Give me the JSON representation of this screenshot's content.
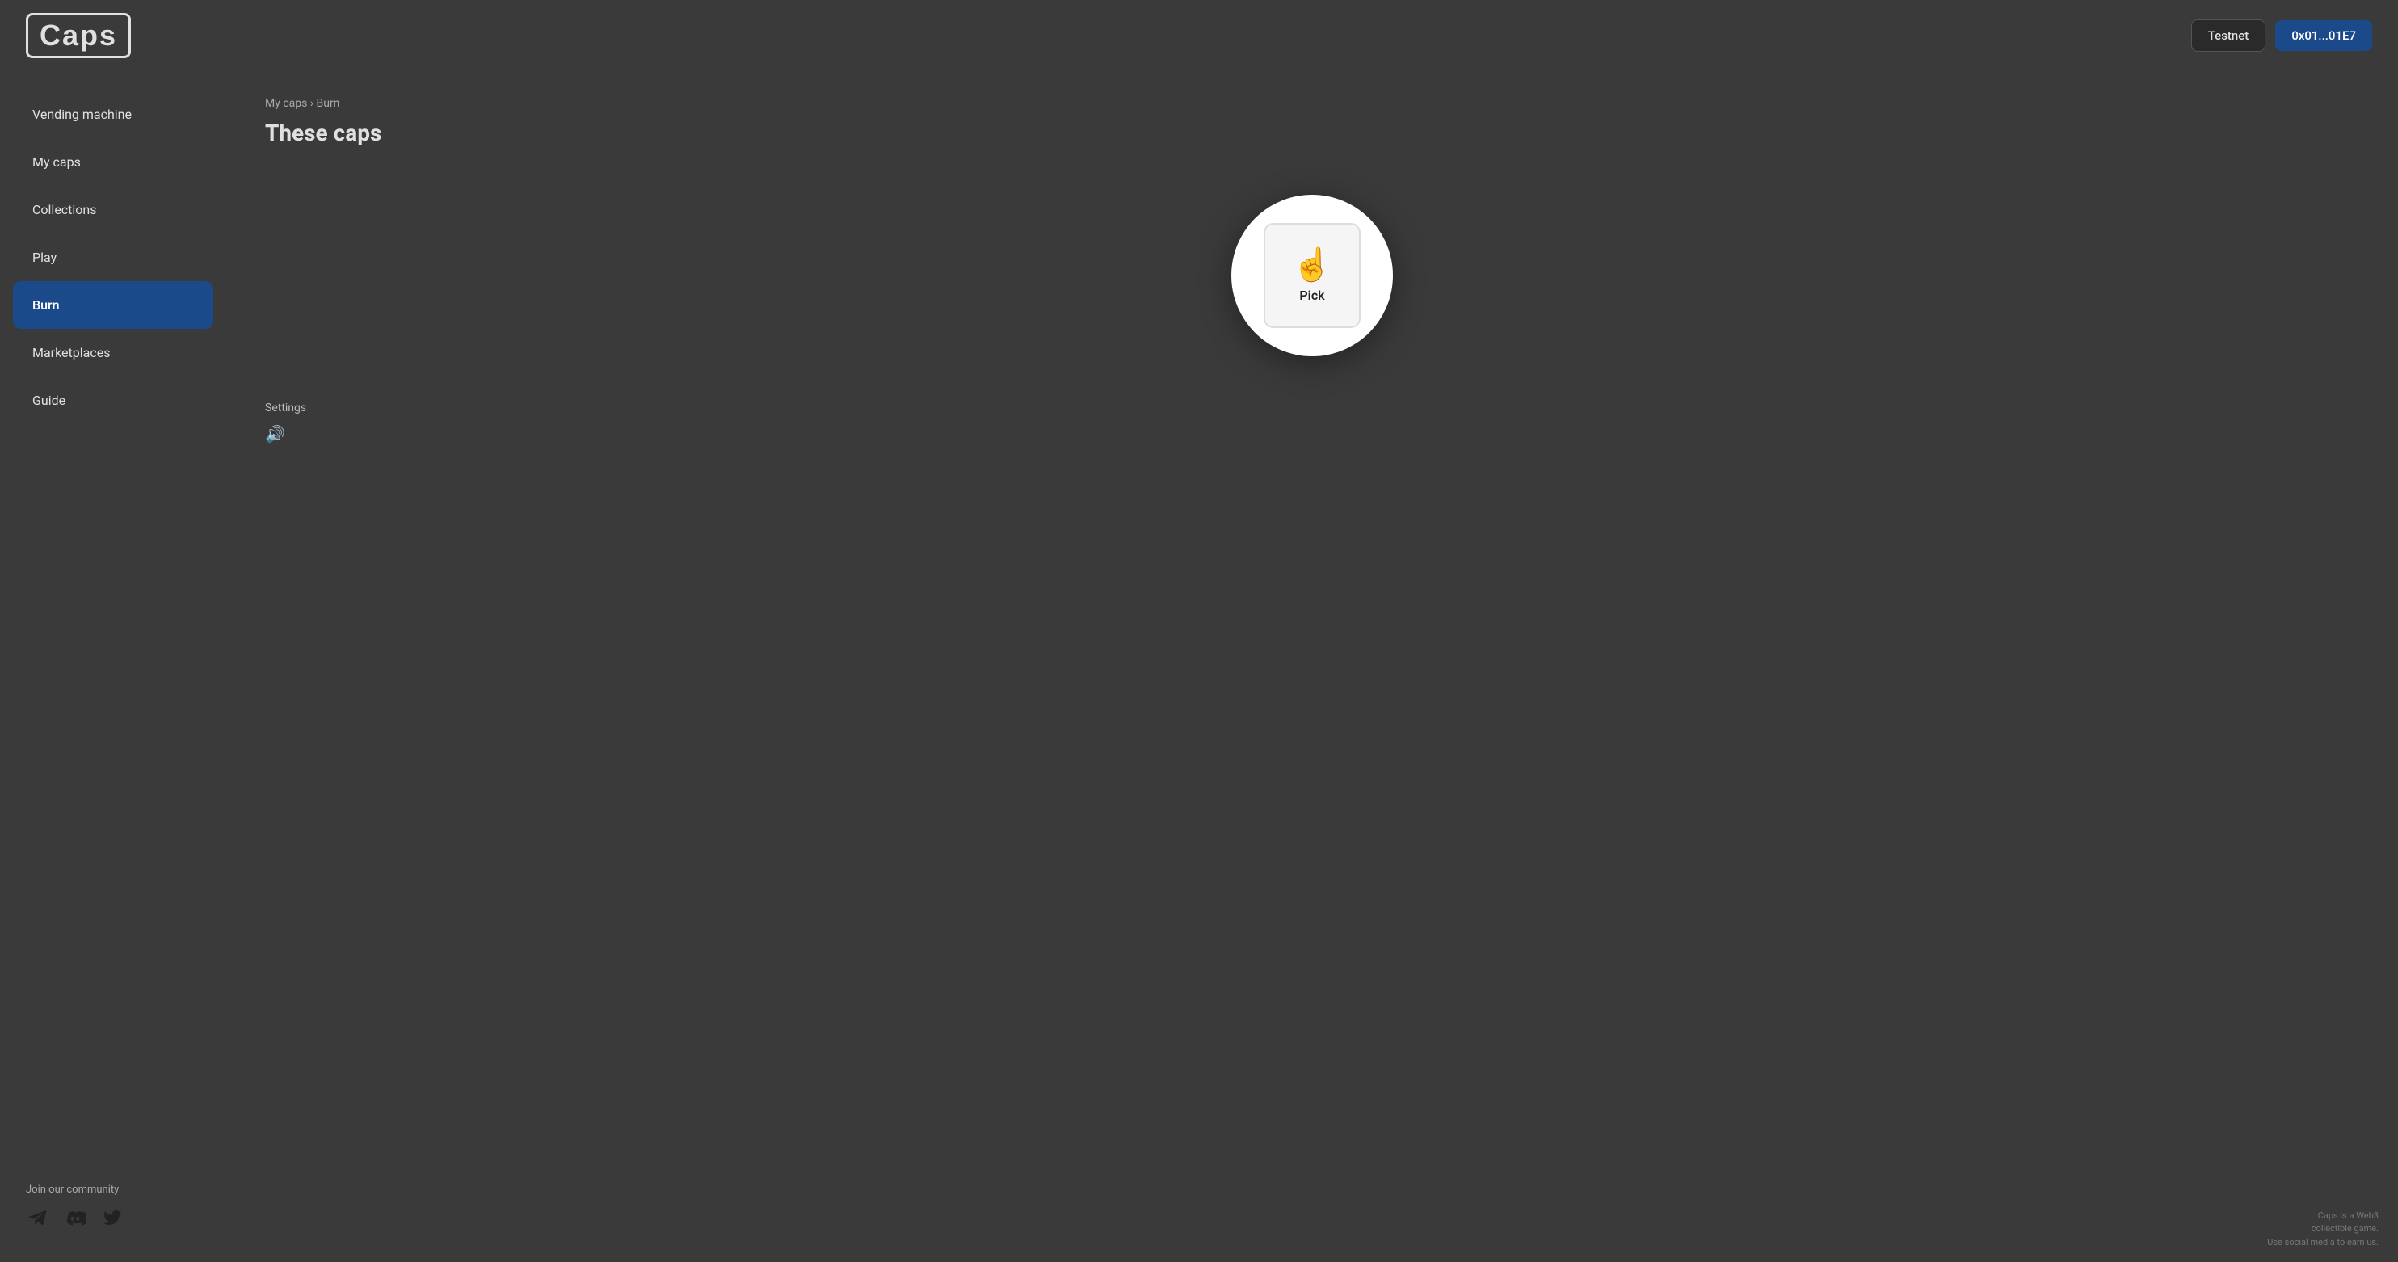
{
  "header": {
    "logo": "Caps",
    "testnet_label": "Testnet",
    "wallet_label": "0x01...01E7"
  },
  "sidebar": {
    "items": [
      {
        "id": "vending-machine",
        "label": "Vending machine",
        "active": false
      },
      {
        "id": "my-caps",
        "label": "My caps",
        "active": false
      },
      {
        "id": "collections",
        "label": "Collections",
        "active": false
      },
      {
        "id": "play",
        "label": "Play",
        "active": false
      },
      {
        "id": "burn",
        "label": "Burn",
        "active": true
      },
      {
        "id": "marketplaces",
        "label": "Marketplaces",
        "active": false
      },
      {
        "id": "guide",
        "label": "Guide",
        "active": false
      }
    ],
    "community": {
      "label": "Join our community"
    }
  },
  "main": {
    "breadcrumb": "My caps › Burn",
    "title": "These caps",
    "pick_button_label": "Pick"
  },
  "settings": {
    "label": "Settings"
  },
  "disclaimer": {
    "line1": "Caps is a Web3",
    "line2": "collectible game.",
    "line3": "Use social media to earn us."
  }
}
